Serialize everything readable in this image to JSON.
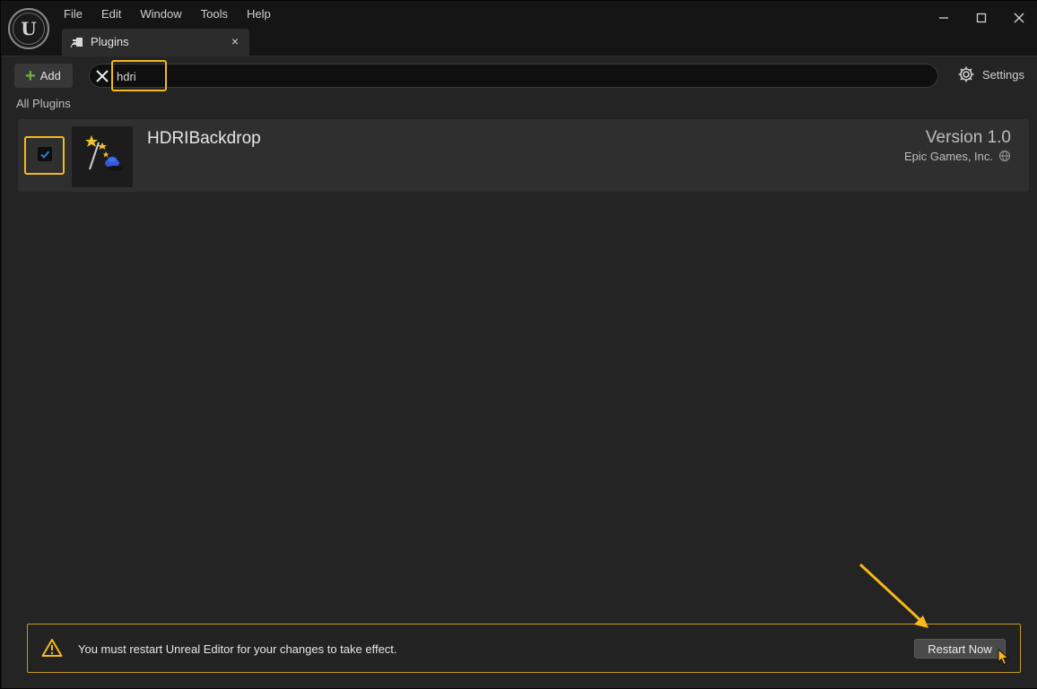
{
  "menu": [
    "File",
    "Edit",
    "Window",
    "Tools",
    "Help"
  ],
  "tab": {
    "label": "Plugins",
    "close": "×"
  },
  "toolbar": {
    "add_label": "Add",
    "search_value": "hdri",
    "settings_label": "Settings"
  },
  "section": {
    "label": "All Plugins"
  },
  "plugin": {
    "name": "HDRIBackdrop",
    "version": "Version 1.0",
    "vendor": "Epic Games, Inc.",
    "enabled": true
  },
  "restart": {
    "message": "You must restart Unreal Editor for your changes to take effect.",
    "button": "Restart Now"
  },
  "colors": {
    "highlight": "#f6b81a",
    "accent_check": "#2e7bd8",
    "add_plus": "#6fb043"
  }
}
